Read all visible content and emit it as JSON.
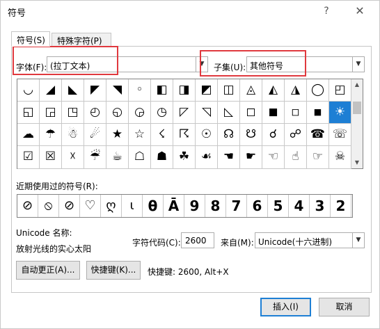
{
  "window": {
    "title": "符号",
    "help_glyph": "?",
    "close_glyph": "✕"
  },
  "tabs": [
    {
      "label": "符号(S)"
    },
    {
      "label": "特殊字符(P)"
    }
  ],
  "font": {
    "label": "字体(F):",
    "value": "(拉丁文本)"
  },
  "subset": {
    "label": "子集(U):",
    "value": "其他符号"
  },
  "symbols": [
    [
      "◡",
      "◢",
      "◣",
      "◤",
      "◥",
      "◦",
      "◧",
      "◨",
      "◩",
      "◫",
      "◬",
      "◭",
      "◮",
      "◯",
      "◰"
    ],
    [
      "◱",
      "◲",
      "◳",
      "◴",
      "◵",
      "◶",
      "◷",
      "◸",
      "◹",
      "◺",
      "◻",
      "◼",
      "◽",
      "◾",
      "☀"
    ],
    [
      "☁",
      "☂",
      "☃",
      "☄",
      "★",
      "☆",
      "☇",
      "☈",
      "☉",
      "☊",
      "☋",
      "☌",
      "☍",
      "☎",
      "☏"
    ],
    [
      "☑",
      "☒",
      "☓",
      "☔",
      "☕",
      "☖",
      "☗",
      "☘",
      "☙",
      "☚",
      "☛",
      "☜",
      "☝",
      "☞",
      "☠"
    ]
  ],
  "selected_symbol": "☀",
  "recent": {
    "label": "近期使用过的符号(R):",
    "items": [
      "⊘",
      "⦸",
      "⊘",
      "♡",
      "ღ",
      "ι",
      "θ",
      "Ā",
      "9",
      "8",
      "7",
      "6",
      "5",
      "4",
      "3",
      "2"
    ]
  },
  "unicode_name": {
    "label": "Unicode 名称:",
    "value": "放射光线的实心太阳"
  },
  "char_code": {
    "label": "字符代码(C):",
    "value": "2600"
  },
  "from": {
    "label": "来自(M):",
    "value": "Unicode(十六进制)"
  },
  "buttons": {
    "autocorrect": "自动更正(A)...",
    "shortcut": "快捷键(K)...",
    "insert": "插入(I)",
    "cancel": "取消"
  },
  "shortcut_info": "快捷键: 2600, Alt+X",
  "accent_color": "#1e7fd4",
  "highlight_color": "#e0393e"
}
